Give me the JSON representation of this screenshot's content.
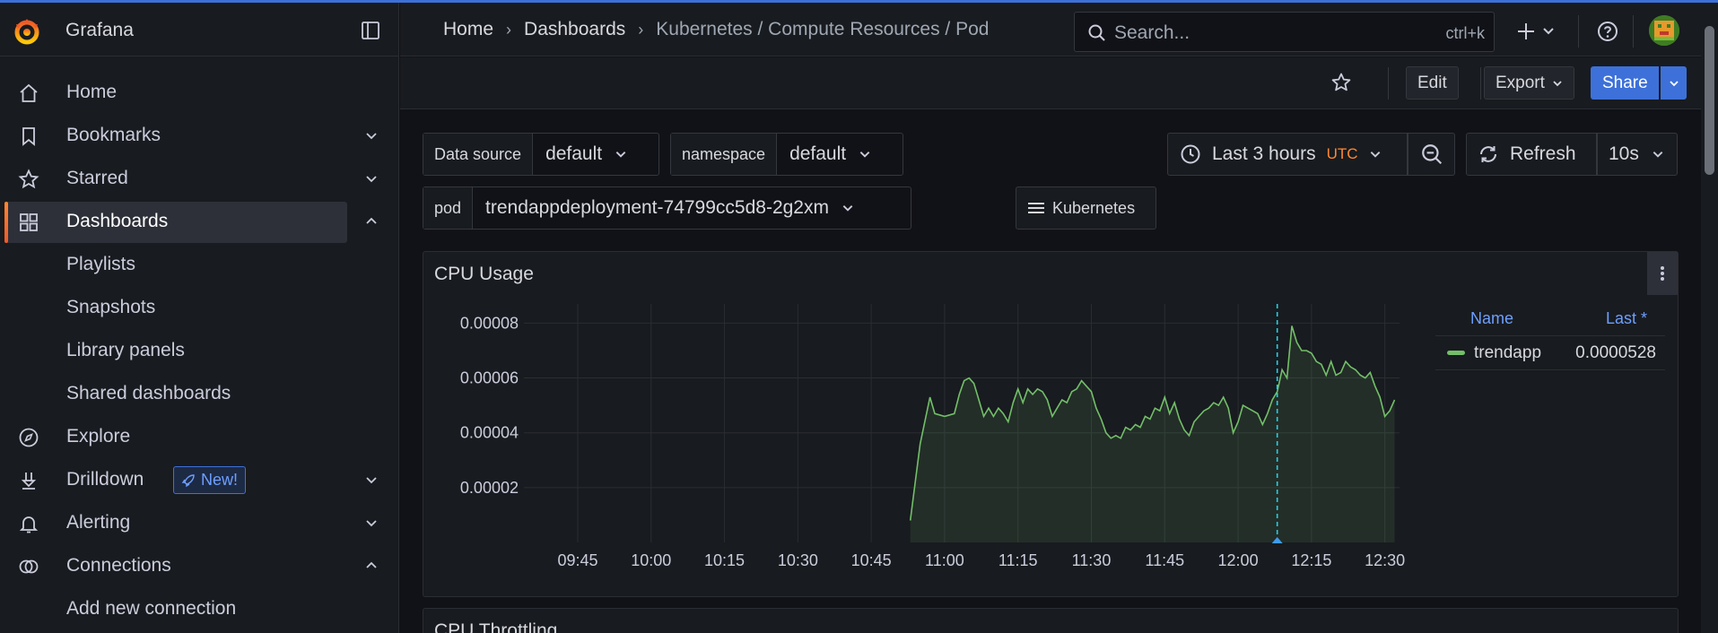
{
  "app": {
    "name": "Grafana"
  },
  "sidebar": {
    "items": [
      {
        "label": "Home",
        "icon": "home-icon"
      },
      {
        "label": "Bookmarks",
        "icon": "bookmark-icon",
        "chevron": "down"
      },
      {
        "label": "Starred",
        "icon": "star-icon",
        "chevron": "down"
      },
      {
        "label": "Dashboards",
        "icon": "apps-icon",
        "chevron": "up",
        "active": true
      },
      {
        "label": "Playlists",
        "sub": true
      },
      {
        "label": "Snapshots",
        "sub": true
      },
      {
        "label": "Library panels",
        "sub": true
      },
      {
        "label": "Shared dashboards",
        "sub": true
      },
      {
        "label": "Explore",
        "icon": "compass-icon"
      },
      {
        "label": "Drilldown",
        "icon": "drilldown-icon",
        "chevron": "down",
        "badge": "New!"
      },
      {
        "label": "Alerting",
        "icon": "bell-icon",
        "chevron": "down"
      },
      {
        "label": "Connections",
        "icon": "connections-icon",
        "chevron": "up"
      },
      {
        "label": "Add new connection",
        "sub": true
      }
    ]
  },
  "topbar": {
    "breadcrumbs": [
      "Home",
      "Dashboards",
      "Kubernetes / Compute Resources / Pod"
    ],
    "search_placeholder": "Search...",
    "search_shortcut": "ctrl+k"
  },
  "toolbar": {
    "edit_label": "Edit",
    "export_label": "Export",
    "share_label": "Share"
  },
  "variables": {
    "datasource": {
      "label": "Data source",
      "value": "default"
    },
    "namespace": {
      "label": "namespace",
      "value": "default"
    },
    "pod": {
      "label": "pod",
      "value": "trendappdeployment-74799cc5d8-2g2xm"
    },
    "links_label": "Kubernetes"
  },
  "time": {
    "range": "Last 3 hours",
    "timezone": "UTC",
    "refresh_label": "Refresh",
    "refresh_interval": "10s"
  },
  "colors": {
    "accent": "#3d71d9",
    "series": "#73bf69",
    "cursor": "#23d0e5",
    "brand": "#f46800"
  },
  "panels": {
    "cpu_usage": {
      "title": "CPU Usage"
    },
    "cpu_throttling": {
      "title": "CPU Throttling"
    }
  },
  "legend": {
    "col_name": "Name",
    "col_last": "Last *",
    "rows": [
      {
        "name": "trendapp",
        "last": "0.0000528"
      }
    ]
  },
  "chart_data": {
    "type": "area",
    "title": "CPU Usage",
    "x_tick_labels": [
      "09:45",
      "10:00",
      "10:15",
      "10:30",
      "10:45",
      "11:00",
      "11:15",
      "11:30",
      "11:45",
      "12:00",
      "12:15",
      "12:30"
    ],
    "y_tick_labels": [
      "0.00002",
      "0.00004",
      "0.00006",
      "0.00008"
    ],
    "xlim": [
      "09:34",
      "12:33"
    ],
    "ylim": [
      0,
      8.7e-05
    ],
    "grid": true,
    "legend_position": "right",
    "series": [
      {
        "name": "trendapp",
        "x": [
          "10:53",
          "10:55",
          "10:57",
          "10:58",
          "11:00",
          "11:02",
          "11:03",
          "11:04",
          "11:05",
          "11:06",
          "11:07",
          "11:08",
          "11:09",
          "11:10",
          "11:11",
          "11:12",
          "11:13",
          "11:14",
          "11:15",
          "11:16",
          "11:17",
          "11:18",
          "11:19",
          "11:20",
          "11:21",
          "11:22",
          "11:23",
          "11:24",
          "11:25",
          "11:26",
          "11:27",
          "11:28",
          "11:29",
          "11:30",
          "11:31",
          "11:32",
          "11:33",
          "11:34",
          "11:35",
          "11:36",
          "11:37",
          "11:38",
          "11:39",
          "11:40",
          "11:41",
          "11:42",
          "11:43",
          "11:44",
          "11:45",
          "11:46",
          "11:47",
          "11:48",
          "11:49",
          "11:50",
          "11:51",
          "11:52",
          "11:53",
          "11:54",
          "11:55",
          "11:56",
          "11:57",
          "11:58",
          "11:59",
          "12:00",
          "12:01",
          "12:02",
          "12:03",
          "12:04",
          "12:05",
          "12:06",
          "12:07",
          "12:08",
          "12:09",
          "12:10",
          "12:11",
          "12:12",
          "12:13",
          "12:14",
          "12:15",
          "12:16",
          "12:17",
          "12:18",
          "12:19",
          "12:20",
          "12:21",
          "12:22",
          "12:23",
          "12:24",
          "12:25",
          "12:26",
          "12:27",
          "12:28",
          "12:29",
          "12:30",
          "12:31",
          "12:32"
        ],
        "values": [
          8e-06,
          3.6e-05,
          5.3e-05,
          4.7e-05,
          4.6e-05,
          4.7e-05,
          5.4e-05,
          5.9e-05,
          6e-05,
          5.8e-05,
          5.2e-05,
          4.6e-05,
          4.9e-05,
          4.6e-05,
          4.9e-05,
          4.7e-05,
          4.4e-05,
          5.1e-05,
          5.6e-05,
          5.1e-05,
          5.6e-05,
          5.4e-05,
          5.6e-05,
          5.5e-05,
          5.2e-05,
          4.6e-05,
          4.9e-05,
          5.2e-05,
          5.1e-05,
          5.5e-05,
          5.6e-05,
          5.9e-05,
          5.7e-05,
          5.5e-05,
          4.9e-05,
          4.5e-05,
          4e-05,
          3.8e-05,
          3.9e-05,
          3.8e-05,
          4.2e-05,
          4.1e-05,
          4.3e-05,
          4.2e-05,
          4.6e-05,
          4.5e-05,
          4.9e-05,
          4.8e-05,
          5.3e-05,
          4.7e-05,
          5.1e-05,
          4.5e-05,
          4.1e-05,
          3.9e-05,
          4.4e-05,
          4.6e-05,
          4.8e-05,
          4.9e-05,
          5.1e-05,
          5e-05,
          5.3e-05,
          4.9e-05,
          4e-05,
          4.4e-05,
          5e-05,
          4.9e-05,
          4.8e-05,
          4.7e-05,
          4.3e-05,
          4.7e-05,
          5.2e-05,
          5.5e-05,
          6.3e-05,
          6e-05,
          7.9e-05,
          7.3e-05,
          7e-05,
          7e-05,
          6.9e-05,
          6.6e-05,
          6.5e-05,
          6.1e-05,
          6.6e-05,
          6.1e-05,
          6.2e-05,
          6.6e-05,
          6.4e-05,
          6.3e-05,
          6.1e-05,
          6e-05,
          6.2e-05,
          5.7e-05,
          5.3e-05,
          4.6e-05,
          4.8e-05,
          5.2e-05
        ]
      }
    ],
    "hover_time": "12:08"
  }
}
